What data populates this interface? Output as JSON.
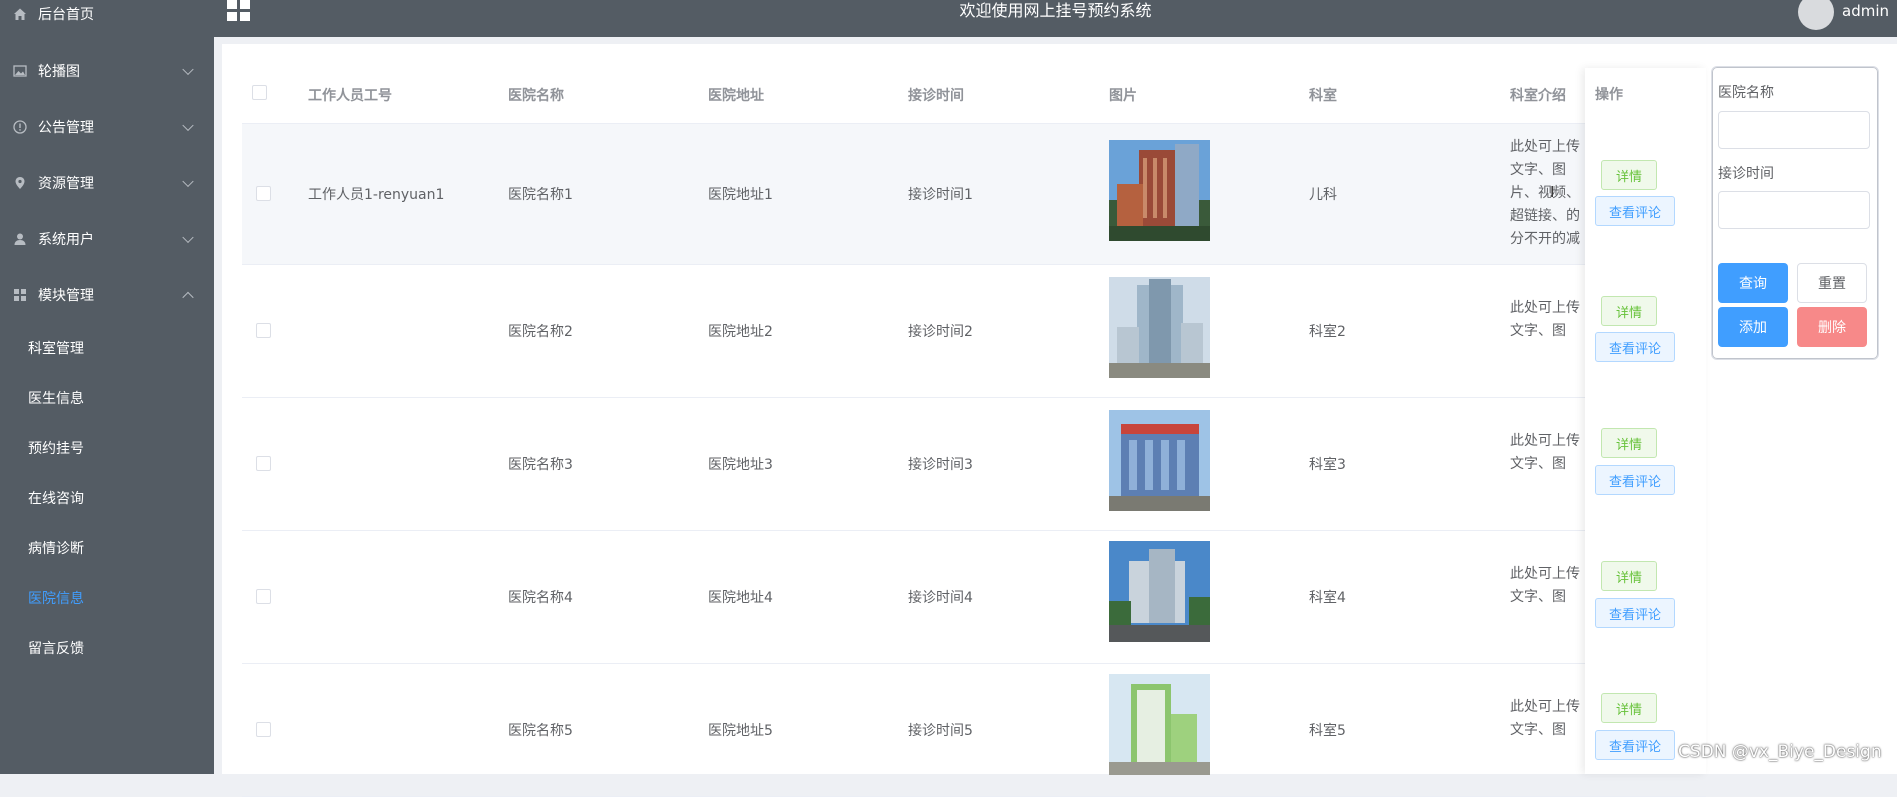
{
  "header": {
    "title": "欢迎使用网上挂号预约系统",
    "user": "admin"
  },
  "sidebar": {
    "menu": [
      {
        "label": "后台首页",
        "icon": "home-icon"
      },
      {
        "label": "轮播图",
        "icon": "picture-icon"
      },
      {
        "label": "公告管理",
        "icon": "info-icon"
      },
      {
        "label": "资源管理",
        "icon": "location-icon"
      },
      {
        "label": "系统用户",
        "icon": "user-icon"
      },
      {
        "label": "模块管理",
        "icon": "menu-grid-icon"
      }
    ],
    "submenu": [
      {
        "label": "科室管理"
      },
      {
        "label": "医生信息"
      },
      {
        "label": "预约挂号"
      },
      {
        "label": "在线咨询"
      },
      {
        "label": "病情诊断"
      },
      {
        "label": "医院信息",
        "active": true
      },
      {
        "label": "留言反馈"
      }
    ]
  },
  "table": {
    "columns": [
      "工作人员工号",
      "医院名称",
      "医院地址",
      "接诊时间",
      "图片",
      "科室",
      "科室介绍",
      "操作"
    ],
    "rows": [
      {
        "staff": "工作人员1-renyuan1",
        "name": "医院名称1",
        "address": "医院地址1",
        "time": "接诊时间1",
        "dept": "儿科",
        "intro": "此处可上传文字、图片、视频、超链接、的分不开的减 是快递费 个 快捷回复"
      },
      {
        "staff": "",
        "name": "医院名称2",
        "address": "医院地址2",
        "time": "接诊时间2",
        "dept": "科室2",
        "intro": "此处可上传文字、图片、视频、超链接、"
      },
      {
        "staff": "",
        "name": "医院名称3",
        "address": "医院地址3",
        "time": "接诊时间3",
        "dept": "科室3",
        "intro": "此处可上传文字、图片、视频、超链接、"
      },
      {
        "staff": "",
        "name": "医院名称4",
        "address": "医院地址4",
        "time": "接诊时间4",
        "dept": "科室4",
        "intro": "此处可上传文字、图片、视频、超链接、"
      },
      {
        "staff": "",
        "name": "医院名称5",
        "address": "医院地址5",
        "time": "接诊时间5",
        "dept": "科室5",
        "intro": "此处可上传文字、图片、视频、超链接、"
      }
    ],
    "actions": {
      "detail": "详情",
      "review": "查看评论"
    }
  },
  "search": {
    "name_label": "医院名称",
    "name_value": "",
    "time_label": "接诊时间",
    "time_value": "",
    "query": "查询",
    "reset": "重置",
    "add": "添加",
    "delete": "删除"
  },
  "watermark": "CSDN @vx_Biye_Design",
  "colors": {
    "sidebar": "#545c64",
    "accent": "#409eff",
    "success": "#67c23a",
    "danger": "#f78989"
  }
}
